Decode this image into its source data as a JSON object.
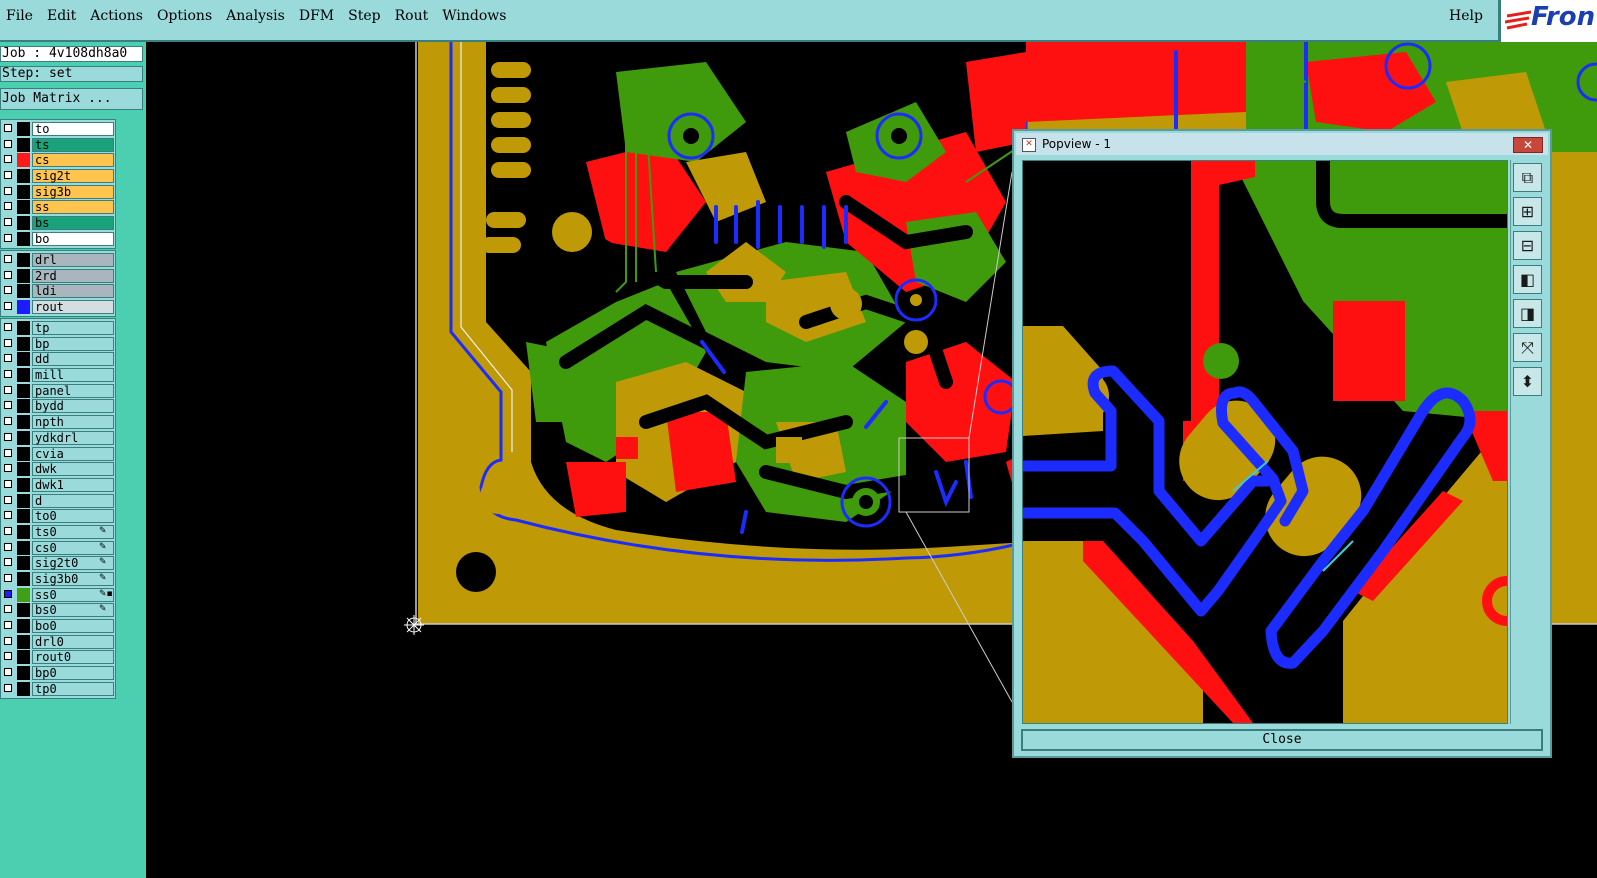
{
  "menubar": {
    "items": [
      "File",
      "Edit",
      "Actions",
      "Options",
      "Analysis",
      "DFM",
      "Step",
      "Rout",
      "Windows"
    ],
    "help": "Help",
    "logo": "Fron"
  },
  "panel": {
    "job": "Job : 4v108dh8a0",
    "step": "Step: set",
    "job_matrix": "Job Matrix ..."
  },
  "layers": {
    "board": [
      {
        "name": "to",
        "color": "#000000",
        "name_bg": "#ffffff",
        "checked": false
      },
      {
        "name": "ts",
        "color": "#000000",
        "name_bg": "#1aa37a",
        "checked": false
      },
      {
        "name": "cs",
        "color": "#ff1a1a",
        "name_bg": "#ffc44e",
        "checked": false
      },
      {
        "name": "sig2t",
        "color": "#000000",
        "name_bg": "#ffc44e",
        "checked": false
      },
      {
        "name": "sig3b",
        "color": "#000000",
        "name_bg": "#ffc44e",
        "checked": false
      },
      {
        "name": "ss",
        "color": "#000000",
        "name_bg": "#ffc44e",
        "checked": false
      },
      {
        "name": "bs",
        "color": "#000000",
        "name_bg": "#1aa37a",
        "checked": false
      },
      {
        "name": "bo",
        "color": "#000000",
        "name_bg": "#ffffff",
        "checked": false
      }
    ],
    "drill": [
      {
        "name": "drl",
        "color": "#000000",
        "name_bg": "#a9b6bd",
        "checked": false
      },
      {
        "name": "2rd",
        "color": "#000000",
        "name_bg": "#a9b6bd",
        "checked": false
      },
      {
        "name": "ldi",
        "color": "#000000",
        "name_bg": "#a9b6bd",
        "checked": false
      },
      {
        "name": "rout",
        "color": "#1c1cff",
        "name_bg": "#d4dde0",
        "checked": false
      }
    ],
    "misc": [
      {
        "name": "tp",
        "color": "#000000",
        "checked": false,
        "icons": ""
      },
      {
        "name": "bp",
        "color": "#000000",
        "checked": false,
        "icons": ""
      },
      {
        "name": "dd",
        "color": "#000000",
        "checked": false,
        "icons": ""
      },
      {
        "name": "mill",
        "color": "#000000",
        "checked": false,
        "icons": ""
      },
      {
        "name": "panel",
        "color": "#000000",
        "checked": false,
        "icons": ""
      },
      {
        "name": "bydd",
        "color": "#000000",
        "checked": false,
        "icons": ""
      },
      {
        "name": "npth",
        "color": "#000000",
        "checked": false,
        "icons": ""
      },
      {
        "name": "ydkdrl",
        "color": "#000000",
        "checked": false,
        "icons": ""
      },
      {
        "name": "cvia",
        "color": "#000000",
        "checked": false,
        "icons": ""
      },
      {
        "name": "dwk",
        "color": "#000000",
        "checked": false,
        "icons": ""
      },
      {
        "name": "dwk1",
        "color": "#000000",
        "checked": false,
        "icons": ""
      },
      {
        "name": "d",
        "color": "#000000",
        "checked": false,
        "icons": ""
      },
      {
        "name": "to0",
        "color": "#000000",
        "checked": false,
        "icons": ""
      },
      {
        "name": "ts0",
        "color": "#000000",
        "checked": false,
        "icons": "✎"
      },
      {
        "name": "cs0",
        "color": "#000000",
        "checked": false,
        "icons": "✎"
      },
      {
        "name": "sig2t0",
        "color": "#000000",
        "checked": false,
        "icons": "✎"
      },
      {
        "name": "sig3b0",
        "color": "#000000",
        "checked": false,
        "icons": "✎"
      },
      {
        "name": "ss0",
        "color": "#3fa018",
        "checked": true,
        "icons": "✎▪"
      },
      {
        "name": "bs0",
        "color": "#000000",
        "checked": false,
        "icons": "✎"
      },
      {
        "name": "bo0",
        "color": "#000000",
        "checked": false,
        "icons": ""
      },
      {
        "name": "drl0",
        "color": "#000000",
        "checked": false,
        "icons": ""
      },
      {
        "name": "rout0",
        "color": "#000000",
        "checked": false,
        "icons": ""
      },
      {
        "name": "bp0",
        "color": "#000000",
        "checked": false,
        "icons": ""
      },
      {
        "name": "tp0",
        "color": "#000000",
        "checked": false,
        "icons": ""
      }
    ]
  },
  "popview": {
    "title": "Popview - 1",
    "close_x": "✕",
    "close_label": "Close",
    "tools": [
      "zoom-window-icon",
      "zoom-in-icon",
      "zoom-out-icon",
      "pan-left-icon",
      "pan-right-icon",
      "zoom-fit-icon",
      "zoom-home-icon"
    ]
  },
  "colors": {
    "panel_bg": "#4ccfb1",
    "menu_bg": "#9adadb",
    "copper_gold": "#bf9a06",
    "copper_green": "#3f9a0c",
    "copper_red": "#ff1010",
    "rout_blue": "#1c2cff"
  }
}
